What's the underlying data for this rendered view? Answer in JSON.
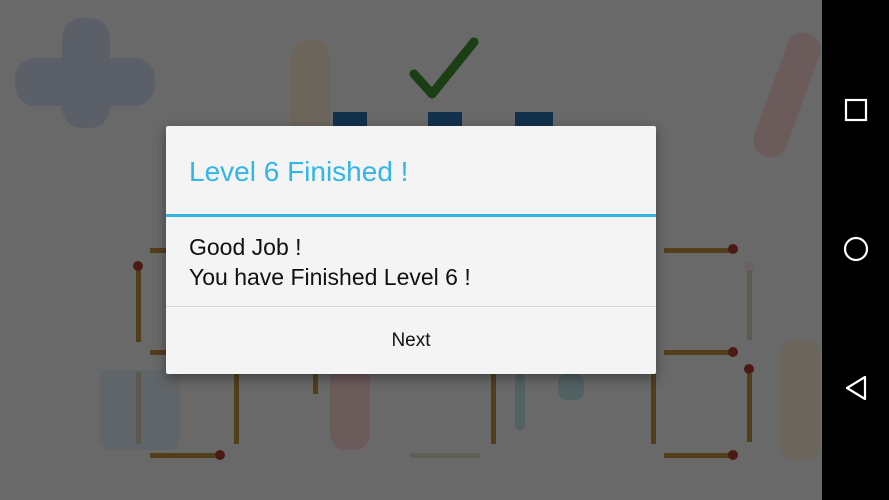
{
  "dialog": {
    "title": "Level 6 Finished !",
    "message_line1": "Good Job !",
    "message_line2": "You have Finished Level 6 !",
    "button_next": "Next"
  },
  "navbar": {
    "buttons": [
      "recent-apps-icon",
      "home-icon",
      "back-icon"
    ]
  },
  "colors": {
    "accent": "#33b5e5",
    "navbar": "#000000",
    "dialog_bg": "#f4f4f4",
    "match_wood": "#b98a3e",
    "match_head": "#a83a2e",
    "check": "#3c8a2e"
  }
}
